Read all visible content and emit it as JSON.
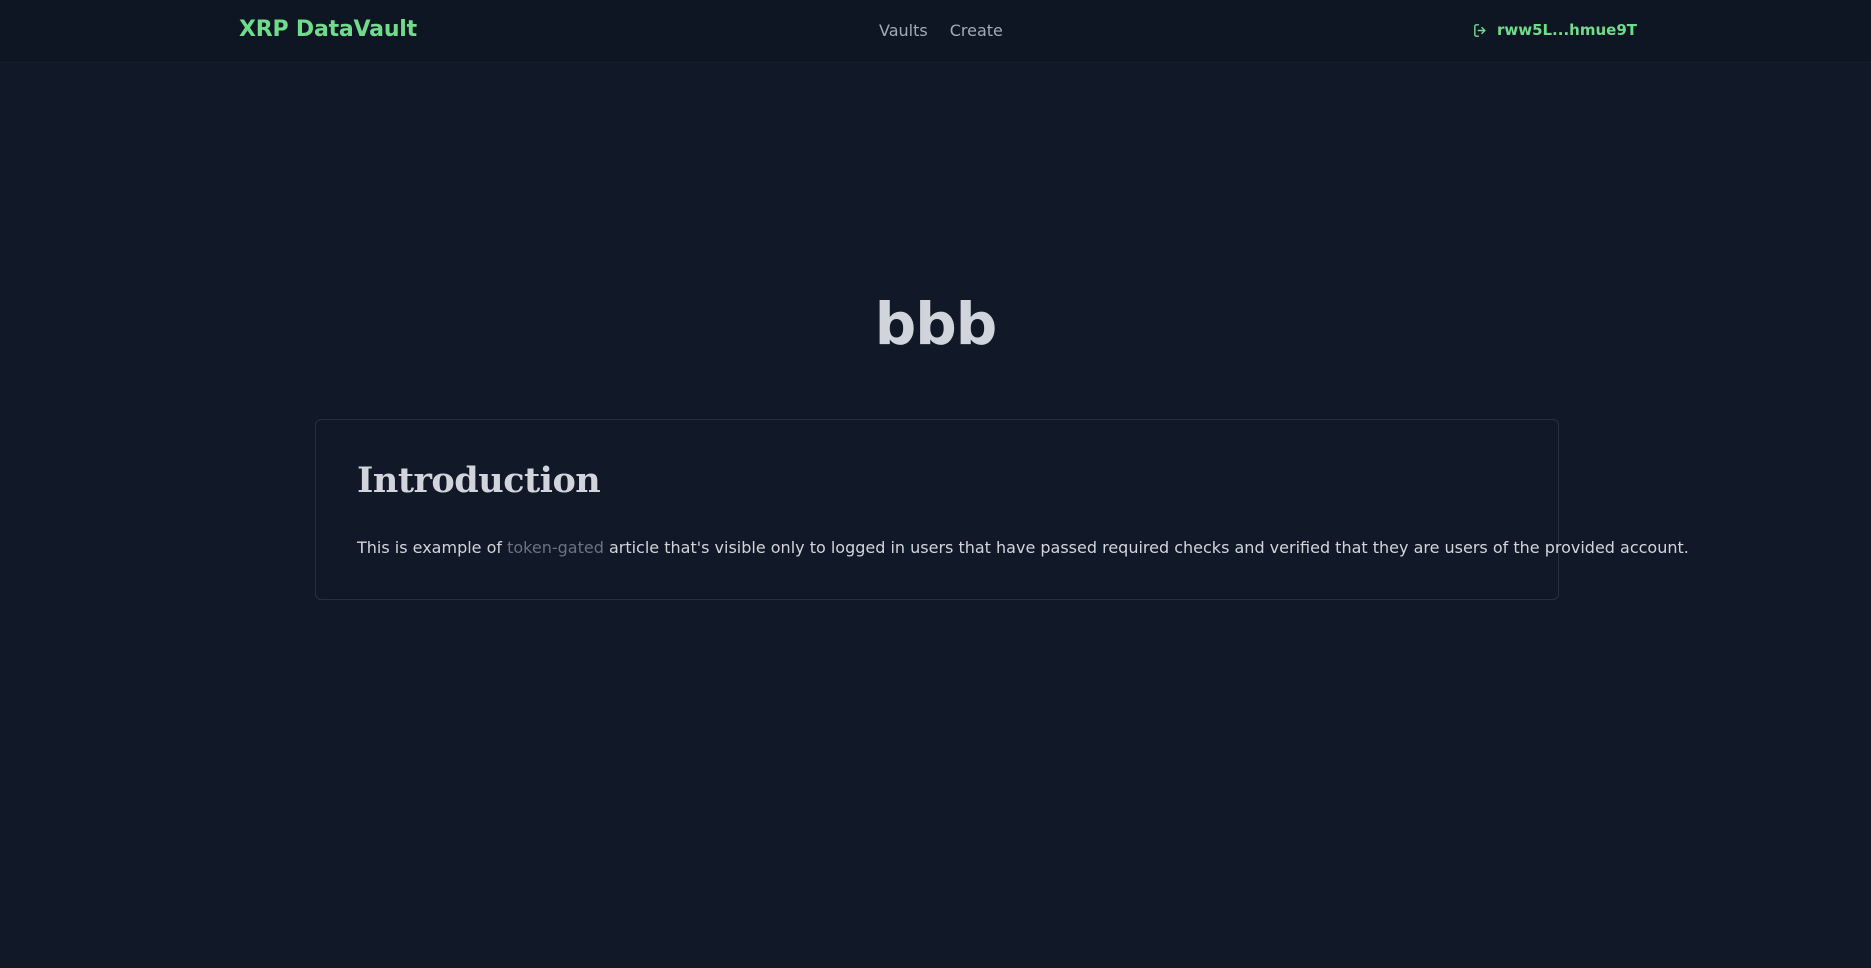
{
  "navbar": {
    "brand": "XRP DataVault",
    "links": [
      "Vaults",
      "Create"
    ],
    "wallet": {
      "icon": "logout-icon",
      "address": "rww5L...hmue9T"
    }
  },
  "article": {
    "title": "bbb",
    "section_heading": "Introduction",
    "text_before": "This is example of ",
    "link_text": "token-gated",
    "text_after": " article that's visible only to logged in users that have passed required checks and verified that they are users of the provided account."
  },
  "colors": {
    "background": "#111827",
    "accent": "#6fdc8c",
    "text": "#d1d5db",
    "muted": "#6b7280"
  }
}
